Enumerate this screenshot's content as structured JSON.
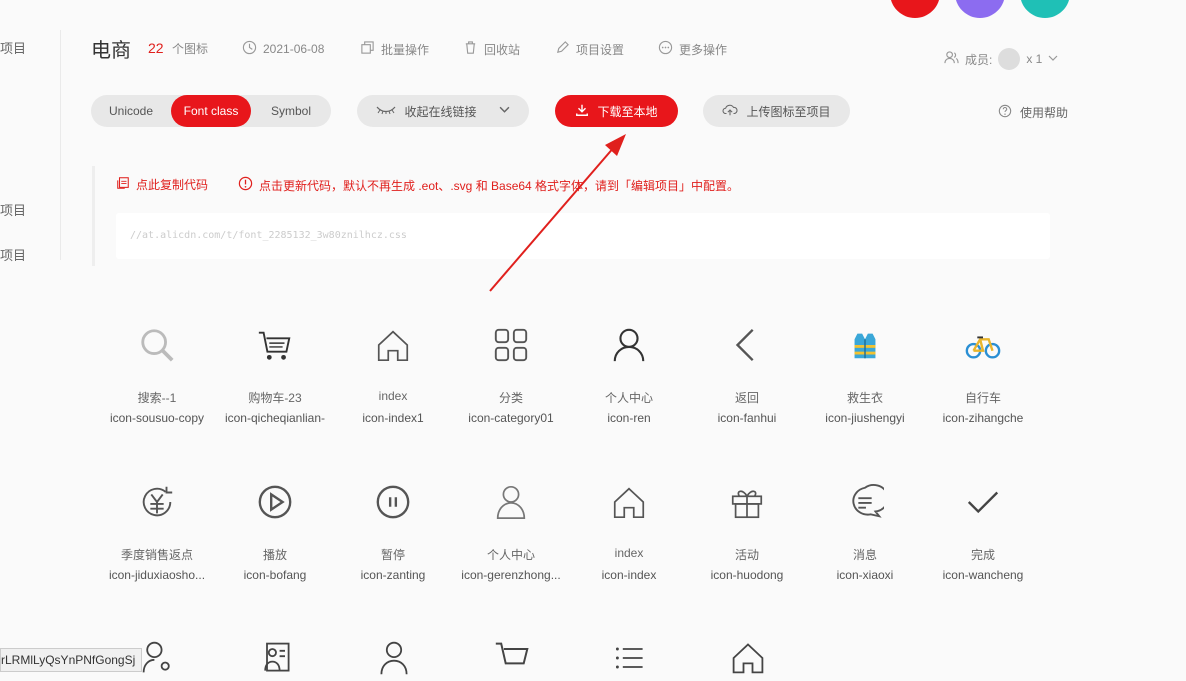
{
  "sidebar": {
    "items": [
      "项目",
      "项目",
      "项目"
    ]
  },
  "header": {
    "title": "电商",
    "icon_count": "22",
    "icon_count_label": "个图标",
    "date": "2021-06-08",
    "batch": "批量操作",
    "recycle": "回收站",
    "settings": "项目设置",
    "more": "更多操作",
    "members_label": "成员:",
    "members_count": "x 1"
  },
  "toolbar": {
    "tabs": [
      "Unicode",
      "Font class",
      "Symbol"
    ],
    "active_tab": "Font class",
    "collapse_link": "收起在线链接",
    "download": "下载至本地",
    "upload": "上传图标至项目",
    "help": "使用帮助"
  },
  "code_panel": {
    "copy_code": "点此复制代码",
    "update_notice": "点击更新代码，默认不再生成 .eot、.svg 和 Base64 格式字体，请到「编辑项目」中配置。",
    "code_url": "//at.alicdn.com/t/font_2285132_3w80znilhcz.css"
  },
  "icons": [
    {
      "name": "搜索--1",
      "code": "icon-sousuo-copy",
      "icon": "search-icon"
    },
    {
      "name": "购物车-23",
      "code": "icon-qicheqianlian-",
      "icon": "cart-icon"
    },
    {
      "name": "index",
      "code": "icon-index1",
      "icon": "home-icon"
    },
    {
      "name": "分类",
      "code": "icon-category01",
      "icon": "category-icon"
    },
    {
      "name": "个人中心",
      "code": "icon-ren",
      "icon": "user-icon"
    },
    {
      "name": "返回",
      "code": "icon-fanhui",
      "icon": "back-icon"
    },
    {
      "name": "救生衣",
      "code": "icon-jiushengyi",
      "icon": "life-jacket-icon"
    },
    {
      "name": "自行车",
      "code": "icon-zihangche",
      "icon": "bicycle-icon"
    },
    {
      "name": "季度销售返点",
      "code": "icon-jiduxiaosho...",
      "icon": "rebate-icon"
    },
    {
      "name": "播放",
      "code": "icon-bofang",
      "icon": "play-icon"
    },
    {
      "name": "暂停",
      "code": "icon-zanting",
      "icon": "pause-icon"
    },
    {
      "name": "个人中心",
      "code": "icon-gerenzhong...",
      "icon": "person-icon"
    },
    {
      "name": "index",
      "code": "icon-index",
      "icon": "home-icon"
    },
    {
      "name": "活动",
      "code": "icon-huodong",
      "icon": "gift-icon"
    },
    {
      "name": "消息",
      "code": "icon-xiaoxi",
      "icon": "message-icon"
    },
    {
      "name": "完成",
      "code": "icon-wancheng",
      "icon": "check-icon"
    }
  ],
  "status_url": "rLRMlLyQsYnPNfGongSj",
  "colors": {
    "accent": "#e8161b",
    "purple": "#8c6cf0",
    "teal": "#1fc0b6"
  }
}
